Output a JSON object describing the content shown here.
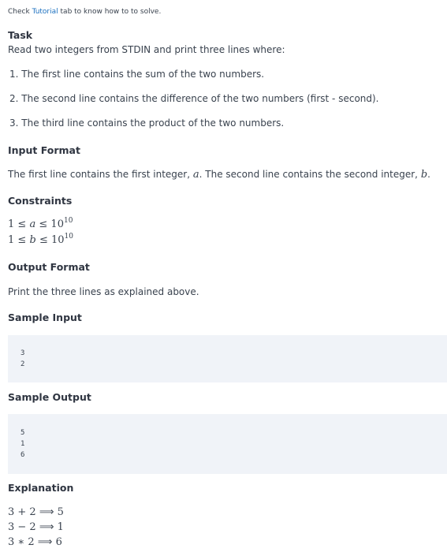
{
  "intro": {
    "prefix": "Check",
    "link": "Tutorial",
    "suffix": "tab to know how to to solve."
  },
  "task": {
    "heading": "Task",
    "description": "Read two integers from STDIN and print three lines where:",
    "items": [
      "1. The first line contains the sum of the two numbers.",
      "2. The second line contains the difference of the two numbers (first - second).",
      "3. The third line contains the product of the two numbers."
    ]
  },
  "input_format": {
    "heading": "Input Format",
    "text_1": "The first line contains the first integer,",
    "var_a": "a",
    "text_2": ". The second line contains the second integer,",
    "var_b": "b",
    "text_3": "."
  },
  "constraints": {
    "heading": "Constraints",
    "c1": {
      "low": "1",
      "op1": "≤",
      "var": "a",
      "op2": "≤",
      "base": "10",
      "exp": "10"
    },
    "c2": {
      "low": "1",
      "op1": "≤",
      "var": "b",
      "op2": "≤",
      "base": "10",
      "exp": "10"
    }
  },
  "output_format": {
    "heading": "Output Format",
    "text": "Print the three lines as explained above."
  },
  "sample_input": {
    "heading": "Sample Input",
    "lines": [
      "3",
      "2"
    ]
  },
  "sample_output": {
    "heading": "Sample Output",
    "lines": [
      "5",
      "1",
      "6"
    ]
  },
  "explanation": {
    "heading": "Explanation",
    "rows": [
      {
        "expr": "3 + 2",
        "arrow": "⟹",
        "result": "5"
      },
      {
        "expr": "3 − 2",
        "arrow": "⟹",
        "result": "1"
      },
      {
        "expr": "3 ∗ 2",
        "arrow": "⟹",
        "result": "6"
      }
    ]
  }
}
